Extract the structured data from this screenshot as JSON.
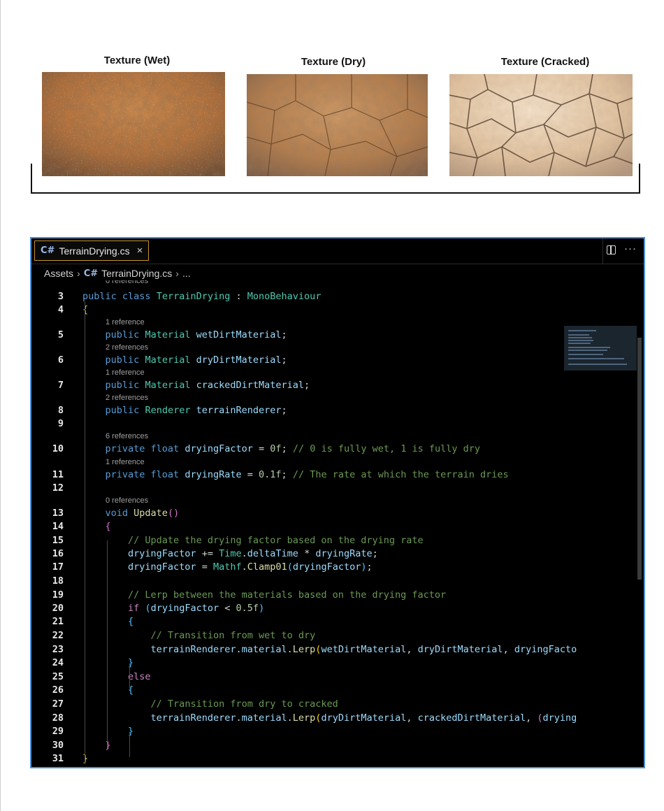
{
  "textures": [
    {
      "label": "Texture (Wet)",
      "icon": "wet-dirt-texture"
    },
    {
      "label": "Texture (Dry)",
      "icon": "dry-dirt-texture"
    },
    {
      "label": "Texture (Cracked)",
      "icon": "cracked-dirt-texture"
    }
  ],
  "editor": {
    "tab_label": "TerrainDrying.cs",
    "tab_icon": "C#",
    "close_glyph": "×",
    "more_glyph": "···",
    "breadcrumb": {
      "root": "Assets",
      "file": "TerrainDrying.cs",
      "tail": "..."
    },
    "lens_top_partial": "0 references",
    "lines": [
      {
        "n": "3",
        "lens": "",
        "html": "<span class='kw'>public class</span> <span class='ty'>TerrainDrying</span> <span class='pl'>:</span> <span class='ty'>MonoBehaviour</span>"
      },
      {
        "n": "4",
        "lens": "",
        "html": "<span class='b1'>{</span>"
      },
      {
        "n": "5",
        "lens": "1 reference",
        "html": "    <span class='kw'>public</span> <span class='ty'>Material</span> <span class='var'>wetDirtMaterial</span><span class='pl'>;</span>"
      },
      {
        "n": "6",
        "lens": "2 references",
        "html": "    <span class='kw'>public</span> <span class='ty'>Material</span> <span class='var'>dryDirtMaterial</span><span class='pl'>;</span>"
      },
      {
        "n": "7",
        "lens": "1 reference",
        "html": "    <span class='kw'>public</span> <span class='ty'>Material</span> <span class='var'>crackedDirtMaterial</span><span class='pl'>;</span>"
      },
      {
        "n": "8",
        "lens": "2 references",
        "html": "    <span class='kw'>public</span> <span class='ty'>Renderer</span> <span class='var'>terrainRenderer</span><span class='pl'>;</span>"
      },
      {
        "n": "9",
        "lens": "",
        "html": ""
      },
      {
        "n": "10",
        "lens": "6 references",
        "html": "    <span class='kw'>private float</span> <span class='var'>dryingFactor</span> <span class='pl'>=</span> <span class='num'>0f</span><span class='pl'>;</span> <span class='com'>// 0 is fully wet, 1 is fully dry</span>"
      },
      {
        "n": "11",
        "lens": "1 reference",
        "html": "    <span class='kw'>private float</span> <span class='var'>dryingRate</span> <span class='pl'>=</span> <span class='num'>0.1f</span><span class='pl'>;</span> <span class='com'>// The rate at which the terrain dries</span>"
      },
      {
        "n": "12",
        "lens": "",
        "html": ""
      },
      {
        "n": "13",
        "lens": "0 references",
        "html": "    <span class='kw'>void</span> <span class='fn'>Update</span><span class='b2'>()</span>"
      },
      {
        "n": "14",
        "lens": "",
        "html": "    <span class='b2'>{</span>"
      },
      {
        "n": "15",
        "lens": "",
        "html": "        <span class='com'>// Update the drying factor based on the drying rate</span>"
      },
      {
        "n": "16",
        "lens": "",
        "html": "        <span class='var'>dryingFactor</span> <span class='pl'>+=</span> <span class='ty'>Time</span><span class='pl'>.</span><span class='var'>deltaTime</span> <span class='pl'>*</span> <span class='var'>dryingRate</span><span class='pl'>;</span>"
      },
      {
        "n": "17",
        "lens": "",
        "html": "        <span class='var'>dryingFactor</span> <span class='pl'>=</span> <span class='ty'>Mathf</span><span class='pl'>.</span><span class='fn'>Clamp01</span><span class='b3'>(</span><span class='var'>dryingFactor</span><span class='b3'>)</span><span class='pl'>;</span>"
      },
      {
        "n": "18",
        "lens": "",
        "html": ""
      },
      {
        "n": "19",
        "lens": "",
        "html": "        <span class='com'>// Lerp between the materials based on the drying factor</span>"
      },
      {
        "n": "20",
        "lens": "",
        "html": "        <span class='ctl'>if</span> <span class='b3'>(</span><span class='var'>dryingFactor</span> <span class='pl'>&lt;</span> <span class='num'>0.5f</span><span class='b3'>)</span>"
      },
      {
        "n": "21",
        "lens": "",
        "html": "        <span class='b3'>{</span>"
      },
      {
        "n": "22",
        "lens": "",
        "html": "            <span class='com'>// Transition from wet to dry</span>"
      },
      {
        "n": "23",
        "lens": "",
        "html": "            <span class='var'>terrainRenderer</span><span class='pl'>.</span><span class='var'>material</span><span class='pl'>.</span><span class='fn'>Lerp</span><span class='b1'>(</span><span class='var'>wetDirtMaterial</span><span class='pl'>,</span> <span class='var'>dryDirtMaterial</span><span class='pl'>,</span> <span class='var'>dryingFacto</span>"
      },
      {
        "n": "24",
        "lens": "",
        "html": "        <span class='b3'>}</span>"
      },
      {
        "n": "25",
        "lens": "",
        "html": "        <span class='ctl'>else</span>"
      },
      {
        "n": "26",
        "lens": "",
        "html": "        <span class='b3'>{</span>"
      },
      {
        "n": "27",
        "lens": "",
        "html": "            <span class='com'>// Transition from dry to cracked</span>"
      },
      {
        "n": "28",
        "lens": "",
        "html": "            <span class='var'>terrainRenderer</span><span class='pl'>.</span><span class='var'>material</span><span class='pl'>.</span><span class='fn'>Lerp</span><span class='b1'>(</span><span class='var'>dryDirtMaterial</span><span class='pl'>,</span> <span class='var'>crackedDirtMaterial</span><span class='pl'>,</span> <span class='b2'>(</span><span class='var'>drying</span>"
      },
      {
        "n": "29",
        "lens": "",
        "html": "        <span class='b3'>}</span>"
      },
      {
        "n": "30",
        "lens": "",
        "html": "    <span class='b2'>}</span>"
      },
      {
        "n": "31",
        "lens": "",
        "html": "<span class='b1'>}</span>"
      }
    ]
  },
  "colors": {
    "editor_border": "#4a8fd8",
    "tab_border": "#c8902a",
    "editor_bg": "#000000"
  }
}
